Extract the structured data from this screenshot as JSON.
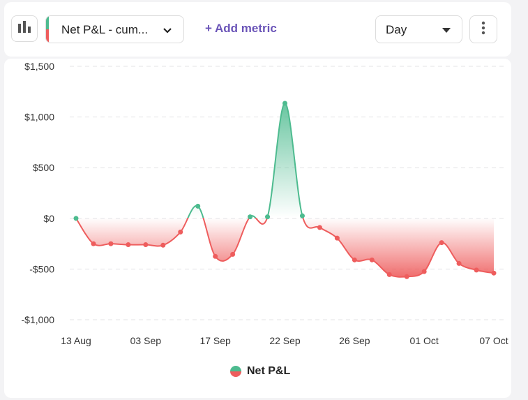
{
  "toolbar": {
    "chart_type_icon": "bar-chart-icon",
    "metric_label": "Net P&L - cum...",
    "metric_chevron_icon": "chevron-down-icon",
    "add_metric_label": "+ Add metric",
    "period_label": "Day",
    "period_caret_icon": "caret-down-icon",
    "more_icon": "more-vertical-icon"
  },
  "legend": {
    "label": "Net P&L"
  },
  "colors": {
    "positive": "#4dbb8f",
    "negative": "#ee5d5d",
    "accent": "#6b55b8"
  },
  "chart_data": {
    "type": "area",
    "title": "",
    "xlabel": "",
    "ylabel": "",
    "ylim": [
      -1000,
      1500
    ],
    "yticks": [
      1500,
      1000,
      500,
      0,
      -500,
      -1000
    ],
    "ytick_labels": [
      "$1,500",
      "$1,000",
      "$500",
      "$0",
      "-$500",
      "-$1,000"
    ],
    "xtick_labels": [
      "13 Aug",
      "03 Sep",
      "17 Sep",
      "22 Sep",
      "26 Sep",
      "01 Oct",
      "07 Oct"
    ],
    "xtick_indices": [
      0,
      4,
      8,
      12,
      16,
      20,
      24
    ],
    "grid": true,
    "legend_position": "bottom",
    "series": [
      {
        "name": "Net P&L",
        "values": [
          0,
          -250,
          -250,
          -260,
          -260,
          -265,
          -135,
          120,
          -375,
          -355,
          15,
          15,
          1135,
          25,
          -90,
          -195,
          -410,
          -410,
          -555,
          -575,
          -525,
          -240,
          -445,
          -510,
          -540
        ]
      }
    ]
  }
}
